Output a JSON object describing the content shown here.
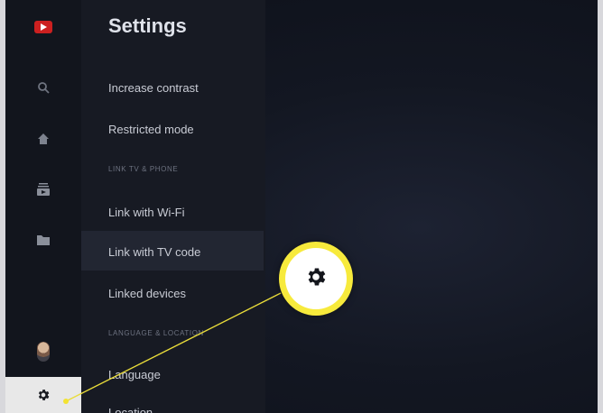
{
  "page_title": "Settings",
  "menu": {
    "items": [
      {
        "label": "Increase contrast"
      },
      {
        "label": "Restricted mode"
      },
      {
        "label": "Link with Wi-Fi"
      },
      {
        "label": "Link with TV code"
      },
      {
        "label": "Linked devices"
      },
      {
        "label": "Language"
      },
      {
        "label": "Location"
      }
    ],
    "sections": [
      {
        "label": "LINK TV & PHONE"
      },
      {
        "label": "LANGUAGE & LOCATION"
      }
    ]
  },
  "rail": {
    "icons": [
      "youtube-logo-icon",
      "search-icon",
      "home-icon",
      "subscriptions-icon",
      "library-icon",
      "avatar",
      "gear-icon"
    ]
  },
  "colors": {
    "accent_yellow": "#f7ea3c",
    "brand_red": "#cc2020",
    "selected_bg": "#e8e8e8"
  }
}
